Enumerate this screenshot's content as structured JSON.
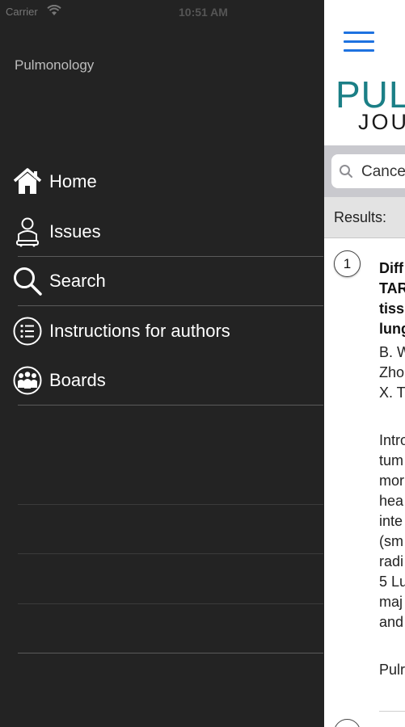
{
  "status_bar": {
    "carrier": "Carrier",
    "time": "10:51 AM",
    "battery_level": 1.0,
    "battery_color": "#2dd04a"
  },
  "menu": {
    "heading": "Pulmonology",
    "items": [
      {
        "label": "Home",
        "icon": "home-icon"
      },
      {
        "label": "Issues",
        "icon": "person-icon"
      },
      {
        "label": "Search",
        "icon": "search-icon"
      },
      {
        "label": "Instructions for authors",
        "icon": "list-icon"
      },
      {
        "label": "Boards",
        "icon": "group-icon"
      }
    ]
  },
  "main": {
    "logo_line1": "PULMONOLOGY",
    "logo_line2": "JOURNAL",
    "search_value": "Cancer",
    "results_label": "Results:",
    "result": {
      "number": "1",
      "title_lines": [
        "Diff",
        "TAR",
        "tiss",
        "lung"
      ],
      "author_lines": [
        "B. W",
        "Zho",
        "X. T"
      ],
      "abstract_lines": [
        "Intro",
        "tum",
        "mor",
        "hea",
        "inte",
        "(sm",
        "radi",
        "5 Lu",
        "maj",
        "and"
      ],
      "journal_line": "Pulr"
    },
    "accent_color": "#1e72e0",
    "logo_color": "#1b7f86"
  }
}
